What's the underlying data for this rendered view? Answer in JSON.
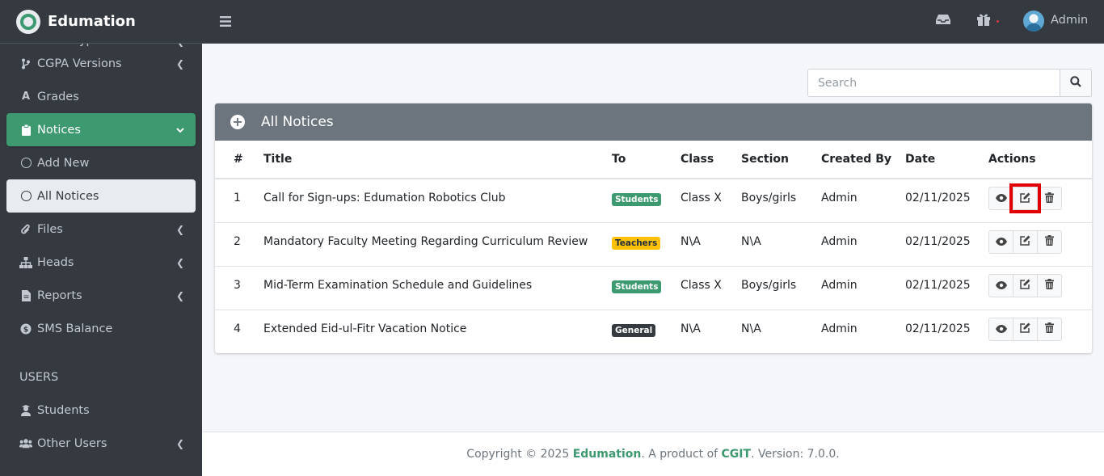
{
  "brand": {
    "name": "Edumation"
  },
  "sidebar": {
    "items": [
      {
        "label": "Exam Types",
        "icon": "edit-icon",
        "has_chevron": true
      },
      {
        "label": "CGPA Versions",
        "icon": "branch-icon",
        "has_chevron": true
      },
      {
        "label": "Grades",
        "icon": "font-a-icon",
        "has_chevron": false
      },
      {
        "label": "Notices",
        "icon": "clipboard-icon",
        "has_chevron": true,
        "expanded": true
      },
      {
        "label": "Add New",
        "icon": "circle-icon"
      },
      {
        "label": "All Notices",
        "icon": "circle-icon"
      },
      {
        "label": "Files",
        "icon": "paperclip-icon",
        "has_chevron": true
      },
      {
        "label": "Heads",
        "icon": "sitemap-icon",
        "has_chevron": true
      },
      {
        "label": "Reports",
        "icon": "file-icon",
        "has_chevron": true
      },
      {
        "label": "SMS Balance",
        "icon": "dollar-coin-icon",
        "has_chevron": false
      }
    ],
    "users_header": "USERS",
    "users_items": [
      {
        "label": "Students",
        "icon": "user-graduate-icon",
        "has_chevron": false
      },
      {
        "label": "Other Users",
        "icon": "users-icon",
        "has_chevron": true
      }
    ]
  },
  "topbar": {
    "user_name": "Admin",
    "icons": [
      "menu-icon",
      "inbox-icon",
      "gift-icon"
    ]
  },
  "search": {
    "placeholder": "Search",
    "value": ""
  },
  "card": {
    "title": "All Notices",
    "columns": [
      "#",
      "Title",
      "To",
      "Class",
      "Section",
      "Created By",
      "Date",
      "Actions"
    ],
    "rows": [
      {
        "num": "1",
        "title": "Call for Sign-ups: Edumation Robotics Club",
        "to": "Students",
        "class": "Class X",
        "section": "Boys/girls",
        "created_by": "Admin",
        "date": "02/11/2025"
      },
      {
        "num": "2",
        "title": "Mandatory Faculty Meeting Regarding Curriculum Review",
        "to": "Teachers",
        "class": "N\\A",
        "section": "N\\A",
        "created_by": "Admin",
        "date": "02/11/2025"
      },
      {
        "num": "3",
        "title": "Mid-Term Examination Schedule and Guidelines",
        "to": "Students",
        "class": "Class X",
        "section": "Boys/girls",
        "created_by": "Admin",
        "date": "02/11/2025"
      },
      {
        "num": "4",
        "title": "Extended Eid-ul-Fitr Vacation Notice",
        "to": "General",
        "class": "N\\A",
        "section": "N\\A",
        "created_by": "Admin",
        "date": "02/11/2025"
      }
    ]
  },
  "footer": {
    "prefix": "Copyright © 2025 ",
    "brand": "Edumation",
    "middle": ". A product of ",
    "company": "CGIT",
    "suffix": ". Version: 7.0.0."
  },
  "colors": {
    "accent": "#3d9970",
    "sidebar_bg": "#343a40",
    "card_header": "#6c757d",
    "highlight": "#e00000"
  }
}
